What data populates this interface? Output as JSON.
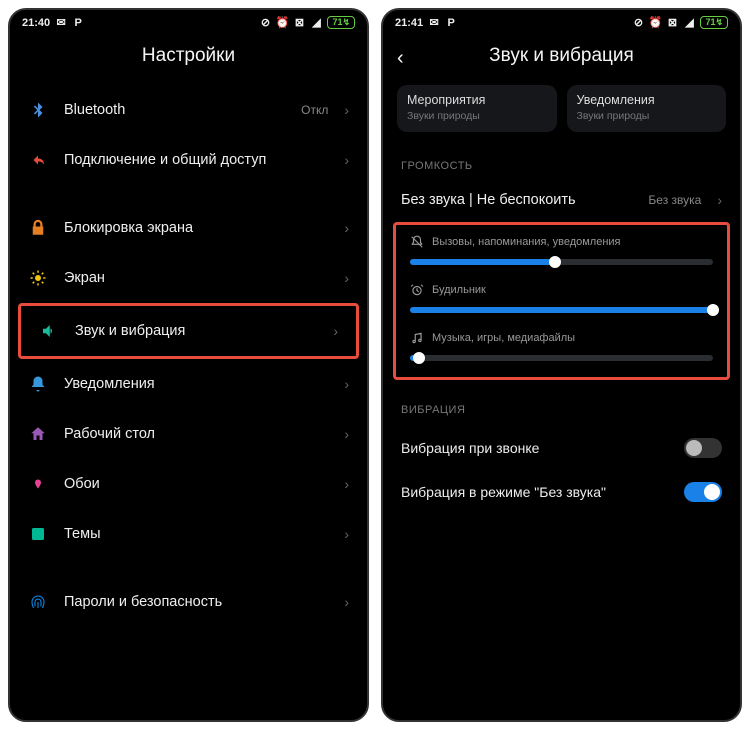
{
  "left": {
    "statusbar": {
      "time": "21:40",
      "battery": "71"
    },
    "title": "Настройки",
    "items": [
      {
        "label": "Bluetooth",
        "value": "Откл",
        "icon": "bluetooth",
        "color": "#4a90e2"
      },
      {
        "label": "Подключение и общий доступ",
        "icon": "share",
        "color": "#e74c3c"
      },
      {
        "label": "Блокировка экрана",
        "icon": "lock",
        "color": "#e67e22"
      },
      {
        "label": "Экран",
        "icon": "brightness",
        "color": "#f1c40f"
      },
      {
        "label": "Звук и вибрация",
        "icon": "speaker",
        "color": "#1abc9c",
        "highlight": true
      },
      {
        "label": "Уведомления",
        "icon": "bell",
        "color": "#3498db"
      },
      {
        "label": "Рабочий стол",
        "icon": "home",
        "color": "#9b59b6"
      },
      {
        "label": "Обои",
        "icon": "wallpaper",
        "color": "#e84393"
      },
      {
        "label": "Темы",
        "icon": "themes",
        "color": "#00b894"
      },
      {
        "label": "Пароли и безопасность",
        "icon": "fingerprint",
        "color": "#0984e3"
      }
    ]
  },
  "right": {
    "statusbar": {
      "time": "21:41",
      "battery": "71"
    },
    "title": "Звук и вибрация",
    "cards": [
      {
        "title": "Мероприятия",
        "sub": "Звуки природы"
      },
      {
        "title": "Уведомления",
        "sub": "Звуки природы"
      }
    ],
    "sections": {
      "volume_header": "ГРОМКОСТЬ",
      "dnd": {
        "label": "Без звука | Не беспокоить",
        "value": "Без звука"
      },
      "sliders": [
        {
          "label": "Вызовы, напоминания, уведомления",
          "icon": "bell-off",
          "percent": 48
        },
        {
          "label": "Будильник",
          "icon": "alarm",
          "percent": 100
        },
        {
          "label": "Музыка, игры, медиафайлы",
          "icon": "music",
          "percent": 3
        }
      ],
      "vibration_header": "ВИБРАЦИЯ",
      "toggles": [
        {
          "label": "Вибрация при звонке",
          "on": false
        },
        {
          "label": "Вибрация в режиме \"Без звука\"",
          "on": true
        }
      ]
    }
  }
}
